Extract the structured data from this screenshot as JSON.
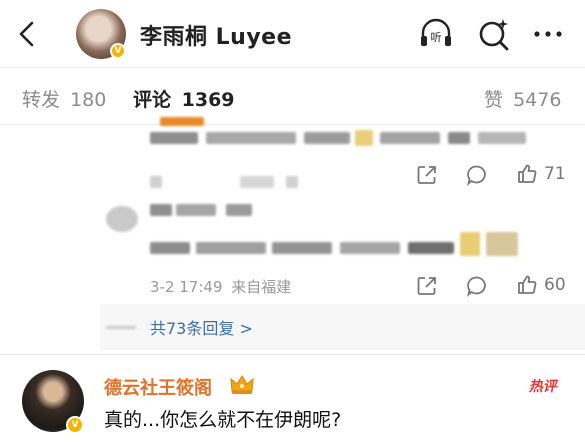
{
  "header": {
    "title": "李雨桐 Luyee",
    "back_icon": "chevron-left-icon",
    "listen_icon": "headphones-listen-icon",
    "listen_glyph": "听",
    "search_icon": "search-sparkle-icon",
    "more_icon": "more-dots-icon",
    "verified_glyph": "V"
  },
  "tabs": {
    "repost_label": "转发",
    "repost_count": "180",
    "comment_label": "评论",
    "comment_count": "1369",
    "like_label": "赞",
    "like_count": "5476"
  },
  "thread": {
    "first_reply": {
      "like_count": "71"
    },
    "second_reply": {
      "timestamp": "3-2 17:49",
      "location": "来自福建",
      "like_count": "60"
    },
    "expand_replies": "共73条回复 >"
  },
  "comment": {
    "username": "德云社王筱阁",
    "badge_icon": "crown-icon",
    "hot_label": "热评",
    "text": "真的...你怎么就不在伊朗呢?",
    "verified_glyph": "V"
  },
  "colors": {
    "username_orange": "#e0722a",
    "link_blue": "#3a6ea5",
    "hot_red": "#e33a2f",
    "verified_gold": "#f6b400"
  }
}
